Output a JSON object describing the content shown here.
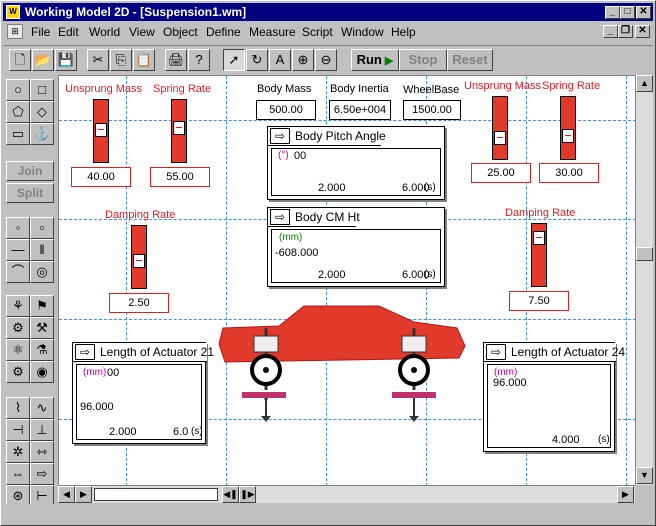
{
  "window": {
    "title": "Working Model 2D - [Suspension1.wm]",
    "app_icon": "wm-app-icon",
    "controls": {
      "minimize": "_",
      "maximize": "□",
      "close": "✕"
    },
    "mdi_controls": {
      "minimize": "_",
      "restore": "❐",
      "close": "✕"
    }
  },
  "menu": [
    "File",
    "Edit",
    "World",
    "View",
    "Object",
    "Define",
    "Measure",
    "Script",
    "Window",
    "Help"
  ],
  "toolbar": {
    "run_label": "Run",
    "stop_label": "Stop",
    "reset_label": "Reset",
    "icons": [
      "new-icon",
      "open-icon",
      "save-icon",
      "cut-icon",
      "copy-icon",
      "paste-icon",
      "print-icon",
      "help-icon",
      "pointer-icon",
      "rotate-icon",
      "text-icon",
      "zoom-in-icon",
      "zoom-out-icon"
    ]
  },
  "palette": {
    "join_label": "Join",
    "split_label": "Split"
  },
  "labels": {
    "unsprung_mass_left": "Unsprung Mass",
    "spring_rate_left": "Spring Rate",
    "body_mass": "Body Mass",
    "body_inertia": "Body Inertia",
    "wheelbase": "WheelBase",
    "unsprung_mass_right": "Unsprung Mass",
    "spring_rate_right": "Spring Rate",
    "damping_rate_left": "Damping Rate",
    "damping_rate_right": "Damping Rate"
  },
  "values": {
    "unsprung_mass_left": "40.00",
    "spring_rate_left": "55.00",
    "body_mass": "500.00",
    "body_inertia": "6.50e+004",
    "wheelbase": "1500.00",
    "unsprung_mass_right": "25.00",
    "spring_rate_right": "30.00",
    "damping_rate_left": "2.50",
    "damping_rate_right": "7.50"
  },
  "meters": {
    "body_pitch": {
      "title": "Body Pitch Angle",
      "unit": "(°)",
      "ytop": "00",
      "x1": "2.000",
      "x2": "6.000",
      "xunit": "(s)"
    },
    "body_cm": {
      "title": "Body CM Ht",
      "unit": "(mm)",
      "yval": "-608.000",
      "x1": "2.000",
      "x2": "6.000",
      "xunit": "(s)"
    },
    "actuator21": {
      "title": "Length of Actuator 21",
      "unit": "(mm)",
      "ytop": "00",
      "yval": "96.000",
      "x1": "2.000",
      "x2": "6.0",
      "xunit": "(s)"
    },
    "actuator24": {
      "title": "Length of Actuator 24",
      "unit": "(mm)",
      "yval": "96.000",
      "x1": "4.000",
      "xunit": "(s)"
    }
  },
  "colors": {
    "car_body": "#e23a2a",
    "label_red": "#e02020",
    "grid": "#3c8cff",
    "titlebar": "#000080"
  }
}
